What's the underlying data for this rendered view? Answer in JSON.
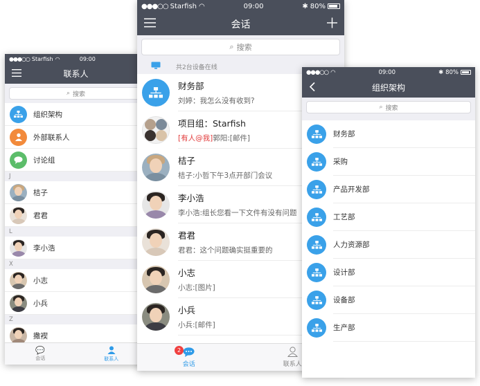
{
  "phone_left": {
    "status": {
      "carrier": "Starfish",
      "time": "09:00"
    },
    "title": "联系人",
    "search_placeholder": "搜索",
    "top_items": [
      {
        "label": "组织架构",
        "icon": "org-chart-icon",
        "color": "#3aa1e9"
      },
      {
        "label": "外部联系人",
        "icon": "external-contact-icon",
        "color": "#f28a3b"
      },
      {
        "label": "讨论组",
        "icon": "chat-group-icon",
        "color": "#5cbd6a"
      }
    ],
    "sections": [
      {
        "letter": "J",
        "contacts": [
          "桔子",
          "君君"
        ]
      },
      {
        "letter": "L",
        "contacts": [
          "李小浩"
        ]
      },
      {
        "letter": "X",
        "contacts": [
          "小志",
          "小兵"
        ]
      },
      {
        "letter": "Z",
        "contacts": [
          "撒褉"
        ]
      }
    ],
    "tabs": [
      {
        "label": "会话"
      },
      {
        "label": "联系人"
      }
    ]
  },
  "phone_center": {
    "status": {
      "carrier": "Starfish",
      "time": "09:00",
      "battery": "80%"
    },
    "title": "会话",
    "search_placeholder": "搜索",
    "device_notice": "共2台设备在线",
    "conversations": [
      {
        "name": "财务部",
        "prefix": "",
        "message": "刘婷：我怎么没有收到?"
      },
      {
        "name": "项目组：Starfish",
        "prefix": "[有人@我]",
        "message": "郭阳:[邮件]"
      },
      {
        "name": "桔子",
        "prefix": "",
        "message": "桔子:小哲下午3点开部门会议"
      },
      {
        "name": "李小浩",
        "prefix": "",
        "message": "李小浩:组长您看一下文件有没有问题"
      },
      {
        "name": "君君",
        "prefix": "",
        "message": "君君：这个问题确实挺重要的"
      },
      {
        "name": "小志",
        "prefix": "",
        "message": "小志:[图片]"
      },
      {
        "name": "小兵",
        "prefix": "",
        "message": "小兵:[邮件]"
      }
    ],
    "tabs": [
      {
        "label": "会话",
        "badge": "2"
      },
      {
        "label": "联系人"
      }
    ]
  },
  "phone_right": {
    "status": {
      "time": "09:00",
      "battery": "80%"
    },
    "title": "组织架构",
    "search_placeholder": "搜索",
    "departments": [
      "财务部",
      "采购",
      "产品开发部",
      "工艺部",
      "人力资源部",
      "设计部",
      "设备部",
      "生产部"
    ]
  }
}
